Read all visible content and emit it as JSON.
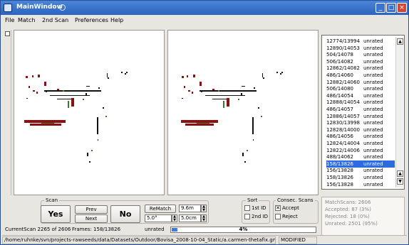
{
  "window": {
    "title": "MainWindow"
  },
  "menu": {
    "items": [
      "File",
      "Match",
      "2nd Scan",
      "Preferences",
      "Help"
    ]
  },
  "scans_list": {
    "rows": [
      {
        "id": "12774/13994",
        "status": "unrated"
      },
      {
        "id": "12890/14053",
        "status": "unrated"
      },
      {
        "id": "504/14078",
        "status": "unrated"
      },
      {
        "id": "506/14082",
        "status": "unrated"
      },
      {
        "id": "12862/14082",
        "status": "unrated"
      },
      {
        "id": "486/14060",
        "status": "unrated"
      },
      {
        "id": "12882/14060",
        "status": "unrated"
      },
      {
        "id": "506/14080",
        "status": "unrated"
      },
      {
        "id": "486/14054",
        "status": "unrated"
      },
      {
        "id": "12888/14054",
        "status": "unrated"
      },
      {
        "id": "486/14057",
        "status": "unrated"
      },
      {
        "id": "12886/14057",
        "status": "unrated"
      },
      {
        "id": "12830/13998",
        "status": "unrated"
      },
      {
        "id": "12828/14000",
        "status": "unrated"
      },
      {
        "id": "486/14056",
        "status": "unrated"
      },
      {
        "id": "12824/14004",
        "status": "unrated"
      },
      {
        "id": "12822/14006",
        "status": "unrated"
      },
      {
        "id": "488/14062",
        "status": "unrated"
      },
      {
        "id": "158/13826",
        "status": "unrated"
      },
      {
        "id": "156/13828",
        "status": "unrated"
      },
      {
        "id": "158/13826",
        "status": "unrated"
      },
      {
        "id": "156/13828",
        "status": "unrated"
      }
    ],
    "selected_index": 18
  },
  "stats": {
    "match_scans": "MatchScans: 2606",
    "accepted": "Accepted: 87   (3%)",
    "rejected": "Rejected: 18   (0%)",
    "unrated": "Unrated: 2501   (95%)"
  },
  "scan_group": {
    "label": "Scan",
    "yes": "Yes",
    "prev": "Prev",
    "next": "Next",
    "no": "No",
    "rematch": "ReMatch",
    "dist1": "9.6m",
    "angle": "5.0°",
    "dist2": "5.0cm"
  },
  "sort_group": {
    "label": "Sort",
    "opt1": "1st ID",
    "opt2": "2nd ID"
  },
  "consec_group": {
    "label": "Consec. Scans",
    "accept": "Accept",
    "reject": "Reject",
    "accept_checked": true,
    "reject_checked": false
  },
  "info": {
    "current_scan": "CurrentScan 2265 of 2606",
    "frames": "Frames: 158/13826",
    "rating": "unrated"
  },
  "progress": {
    "value": 0.04,
    "label": "4%"
  },
  "status": {
    "path": "/home/ruhnke/svn/projects-rawseeds/data/Datasets/Outdoor/Bovisa_2008-10-04_Static/a.carmen-thetafix.gm2dl",
    "state": "MODIFIED"
  },
  "colors": {
    "selection": "#2d6be0",
    "progress": "#3f78e0",
    "title_bar": "#2d63be",
    "scan_red": "#8b1010"
  }
}
